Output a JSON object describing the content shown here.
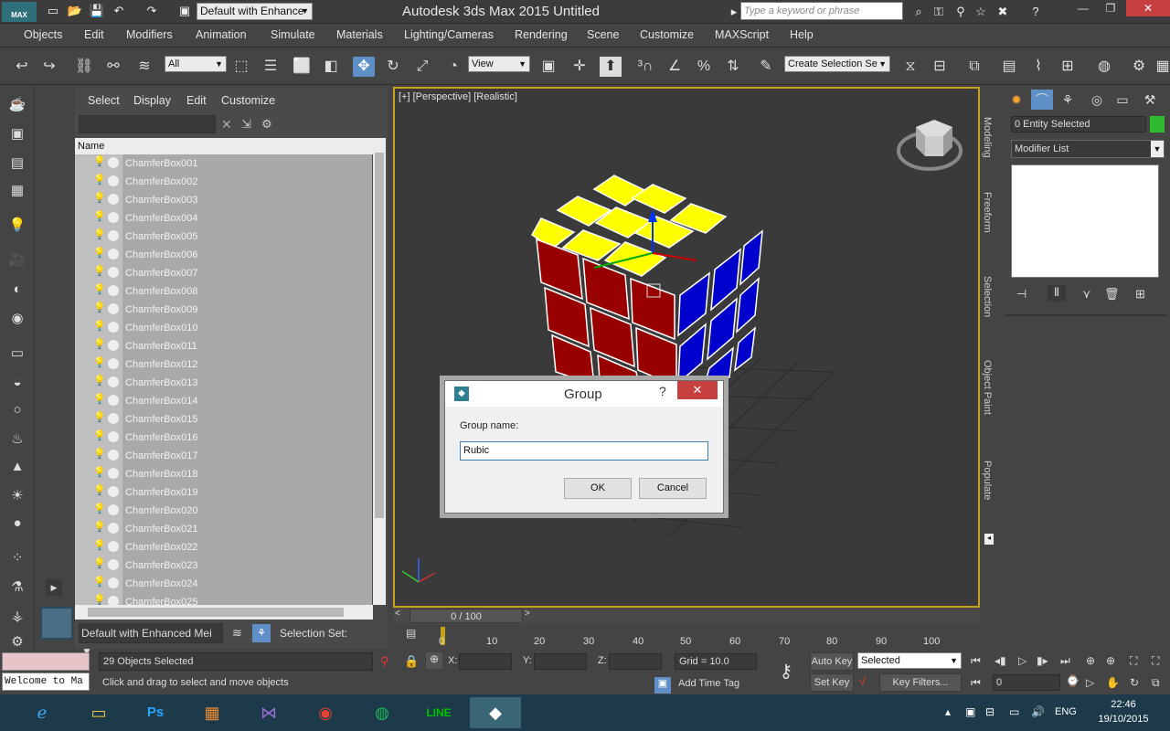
{
  "titlebar": {
    "app_logo": "MAX",
    "workspace": "Default with Enhance",
    "window_title": "Autodesk 3ds Max  2015      Untitled",
    "search_placeholder": "Type a keyword or phrase",
    "win_min": "—",
    "win_restore": "❐",
    "win_close": "✕"
  },
  "menu": [
    "Objects",
    "Edit",
    "Modifiers",
    "Animation",
    "Simulate",
    "Materials",
    "Lighting/Cameras",
    "Rendering",
    "Scene",
    "Customize",
    "MAXScript",
    "Help"
  ],
  "toolbar": {
    "selection_filter": "All",
    "ref_coord": "View",
    "named_selection_placeholder": "Create Selection Se"
  },
  "explorer": {
    "menu": [
      "Select",
      "Display",
      "Edit",
      "Customize"
    ],
    "column_header": "Name",
    "items": [
      "ChamferBox001",
      "ChamferBox002",
      "ChamferBox003",
      "ChamferBox004",
      "ChamferBox005",
      "ChamferBox006",
      "ChamferBox007",
      "ChamferBox008",
      "ChamferBox009",
      "ChamferBox010",
      "ChamferBox011",
      "ChamferBox012",
      "ChamferBox013",
      "ChamferBox014",
      "ChamferBox015",
      "ChamferBox016",
      "ChamferBox017",
      "ChamferBox018",
      "ChamferBox019",
      "ChamferBox020",
      "ChamferBox021",
      "ChamferBox022",
      "ChamferBox023",
      "ChamferBox024",
      "ChamferBox025"
    ],
    "layer_explorer": "Default with Enhanced Mei",
    "selection_set_label": "Selection Set:"
  },
  "viewport": {
    "label": "[+] [Perspective] [Realistic]",
    "colors": {
      "top": "#ffff00",
      "front": "#990000",
      "side": "#0000cc",
      "border": "#c4a21a"
    }
  },
  "dialog": {
    "title": "Group",
    "help": "?",
    "close": "✕",
    "label": "Group name:",
    "value": "Rubic",
    "ok": "OK",
    "cancel": "Cancel"
  },
  "command_panel": {
    "entity": "0 Entity Selected",
    "modifier_list": "Modifier List",
    "swatch_color": "#2fba2f"
  },
  "ribbon": [
    "Modeling",
    "Freeform",
    "Selection",
    "Object Paint",
    "Populate"
  ],
  "timeline": {
    "slider": "0 / 100",
    "ticks": [
      "0",
      "10",
      "20",
      "30",
      "40",
      "50",
      "60",
      "70",
      "80",
      "90",
      "100"
    ]
  },
  "status": {
    "maxscript": "Welcome to Ma",
    "objects_selected": "29 Objects Selected",
    "prompt": "Click and drag to select and move objects",
    "x_label": "X:",
    "y_label": "Y:",
    "z_label": "Z:",
    "grid": "Grid = 10.0",
    "add_time_tag": "Add Time Tag",
    "auto_key": "Auto Key",
    "set_key": "Set Key",
    "selected": "Selected",
    "key_filters": "Key Filters...",
    "frame": "0"
  },
  "taskbar": {
    "lang": "ENG",
    "time": "22:46",
    "date": "19/10/2015"
  }
}
